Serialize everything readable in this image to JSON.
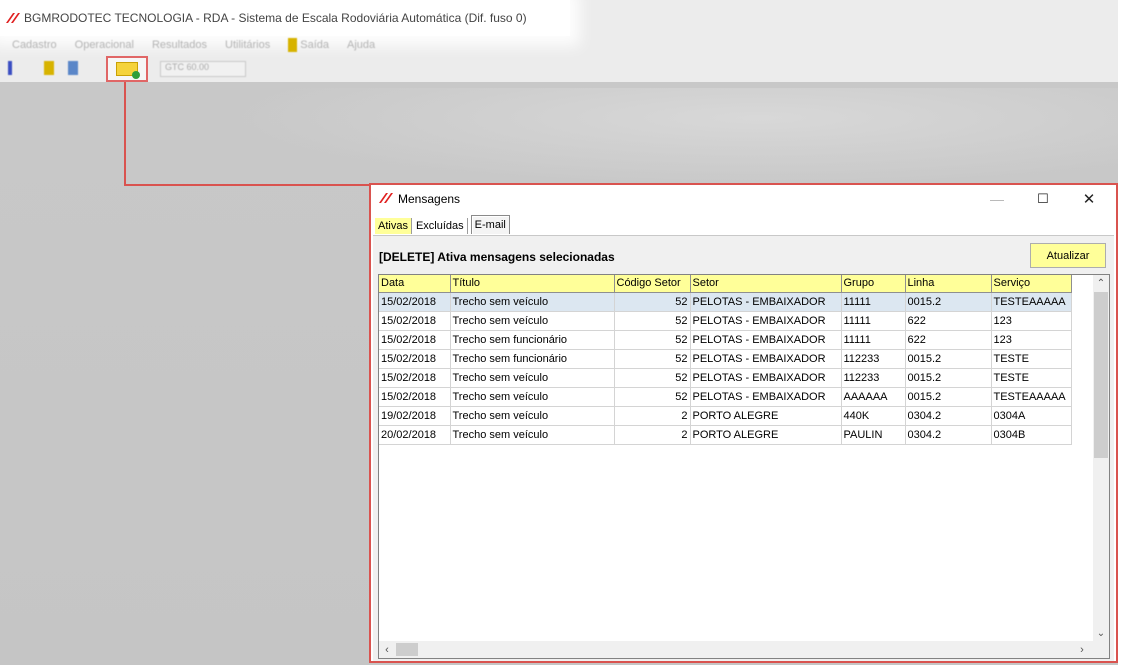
{
  "app": {
    "title": "BGMRODOTEC TECNOLOGIA - RDA - Sistema de Escala Rodoviária Automática (Dif. fuso 0)",
    "menu": [
      "Cadastro",
      "Operacional",
      "Resultados",
      "Utilitários",
      "Saída",
      "Ajuda"
    ],
    "combo_value": "GTC 60.00"
  },
  "dialog": {
    "title": "Mensagens",
    "tabs": [
      "Ativas",
      "Excluídas",
      "E-mail"
    ],
    "active_tab": "E-mail",
    "header_text": "[DELETE] Ativa mensagens selecionadas",
    "refresh_label": "Atualizar",
    "columns": [
      "Data",
      "Título",
      "Código Setor",
      "Setor",
      "Grupo",
      "Linha",
      "Serviço"
    ],
    "rows": [
      [
        "15/02/2018",
        "Trecho sem veículo",
        "52",
        "PELOTAS - EMBAIXADOR",
        "11111",
        "0015.2",
        "TESTEAAAAA"
      ],
      [
        "15/02/2018",
        "Trecho sem veículo",
        "52",
        "PELOTAS - EMBAIXADOR",
        "11111",
        "622",
        "123"
      ],
      [
        "15/02/2018",
        "Trecho sem funcionário",
        "52",
        "PELOTAS - EMBAIXADOR",
        "11111",
        "622",
        "123"
      ],
      [
        "15/02/2018",
        "Trecho sem funcionário",
        "52",
        "PELOTAS - EMBAIXADOR",
        "112233",
        "0015.2",
        "TESTE"
      ],
      [
        "15/02/2018",
        "Trecho sem veículo",
        "52",
        "PELOTAS - EMBAIXADOR",
        "112233",
        "0015.2",
        "TESTE"
      ],
      [
        "15/02/2018",
        "Trecho sem veículo",
        "52",
        "PELOTAS - EMBAIXADOR",
        "AAAAAA",
        "0015.2",
        "TESTEAAAAA"
      ],
      [
        "19/02/2018",
        "Trecho sem veículo",
        "2",
        "PORTO ALEGRE",
        "440K",
        "0304.2",
        "0304A"
      ],
      [
        "20/02/2018",
        "Trecho sem veículo",
        "2",
        "PORTO ALEGRE",
        "PAULIN",
        "0304.2",
        "0304B"
      ]
    ],
    "selected_row": 0
  },
  "colors": {
    "accent_yellow": "#ffff99",
    "highlight_red": "#d9534f",
    "selection": "#dce7f1"
  },
  "icons": [
    "app-logo-icon",
    "minimize-icon",
    "maximize-icon",
    "close-icon",
    "new-message-icon",
    "scroll-up-icon",
    "scroll-down-icon",
    "scroll-left-icon",
    "scroll-right-icon"
  ]
}
